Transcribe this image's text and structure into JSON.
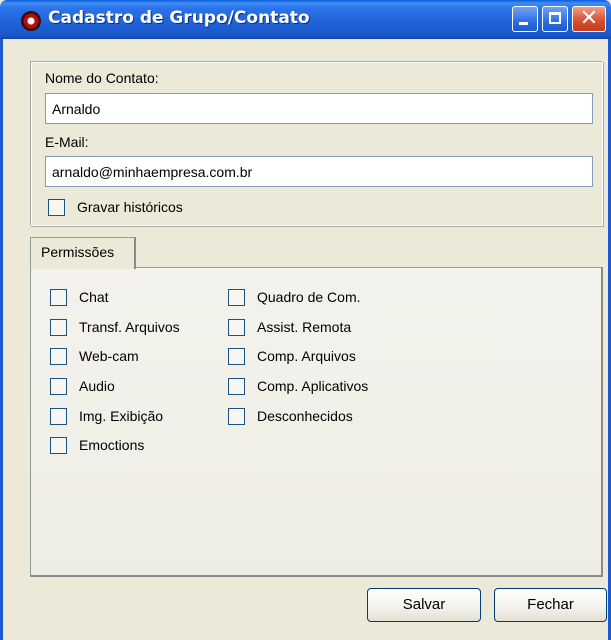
{
  "window": {
    "title": "Cadastro de Grupo/Contato",
    "title_bar_color": "#2c74ea",
    "close_button_color": "#d8502f",
    "controls": {
      "minimize": "minimize-icon",
      "maximize": "maximize-icon",
      "close": "✕"
    }
  },
  "form": {
    "name_label": "Nome do Contato:",
    "name_value": "Arnaldo",
    "email_label": "E-Mail:",
    "email_value": "arnaldo@minhaempresa.com.br",
    "save_history": {
      "label": "Gravar históricos",
      "checked": false
    }
  },
  "tabs": [
    {
      "label": "Permissões",
      "active": true
    }
  ],
  "permissions": {
    "left": [
      {
        "label": "Chat",
        "checked": false
      },
      {
        "label": "Transf. Arquivos",
        "checked": false
      },
      {
        "label": "Web-cam",
        "checked": false
      },
      {
        "label": "Audio",
        "checked": false
      },
      {
        "label": "Img. Exibição",
        "checked": false
      },
      {
        "label": "Emoctions",
        "checked": false
      }
    ],
    "right": [
      {
        "label": "Quadro de Com.",
        "checked": false
      },
      {
        "label": "Assist. Remota",
        "checked": false
      },
      {
        "label": "Comp. Arquivos",
        "checked": false
      },
      {
        "label": "Comp. Aplicativos",
        "checked": false
      },
      {
        "label": "Desconhecidos",
        "checked": false
      }
    ]
  },
  "buttons": {
    "save": "Salvar",
    "close": "Fechar"
  }
}
